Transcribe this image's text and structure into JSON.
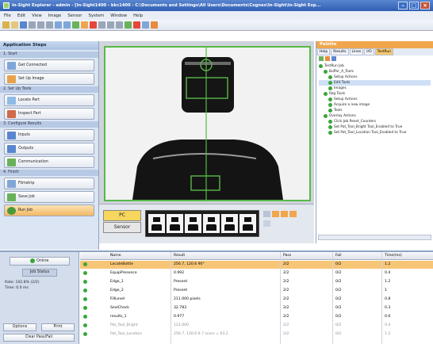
{
  "window": {
    "title": "In-Sight Explorer - admin - [In-Sight1400 - bkc1400 - C:\\Documents and Settings\\All Users\\Documents\\Cognex\\In-Sight\\In-Sight Exp..."
  },
  "menu": [
    "File",
    "Edit",
    "View",
    "Image",
    "Sensor",
    "System",
    "Window",
    "Help"
  ],
  "left": {
    "title": "Application Steps",
    "sections": [
      {
        "header": "1. Start",
        "items": [
          "Get Connected",
          "Set Up Image"
        ]
      },
      {
        "header": "2. Set Up Tools",
        "items": [
          "Locate Part",
          "Inspect Part"
        ]
      },
      {
        "header": "3. Configure Results",
        "items": [
          "Inputs",
          "Outputs",
          "Communication"
        ]
      },
      {
        "header": "4. Finish",
        "items": [
          "Filmstrip",
          "Save Job",
          "Run Job"
        ]
      }
    ]
  },
  "filmstrip": {
    "pc_label": "PC",
    "sensor_label": "Sensor"
  },
  "palette": {
    "title": "Palette",
    "tabs": [
      "Help",
      "Results",
      "Lines",
      "I/O",
      "TestRun"
    ],
    "tree": [
      "TestRun Job",
      "Buffer_A_Tools",
      "Setup Actions",
      "Edit Tools",
      "Images",
      "Reg Tools",
      "Setup Actions",
      "Acquire a new image",
      "Tools",
      "Overlay Actions",
      "Click Job Reset_Counters",
      "Set Pat_Tool_Bright Tool_Enabled to True",
      "Set Pat_Tool_Location Tool_Enabled to True"
    ]
  },
  "status": {
    "online_label": "Online",
    "job_status": "Job Status",
    "rate": "Rate: 102.8% (2/2)",
    "time": "Time: 0.0 ms",
    "options_label": "Options",
    "print_label": "Print",
    "clear_label": "Clear Pass/Fail"
  },
  "table": {
    "columns": [
      "Name",
      "Result",
      "Pass",
      "Fail",
      "Time(ms)"
    ],
    "rows": [
      {
        "name": "LocateBottle",
        "result": "256.7, 120.6 90°",
        "pass": "2/2",
        "fail": "0/2",
        "time": "1.2",
        "selected": true
      },
      {
        "name": "EquipPresence",
        "result": "0.992",
        "pass": "2/2",
        "fail": "0/2",
        "time": "0.4"
      },
      {
        "name": "Edge_1",
        "result": "Present",
        "pass": "2/2",
        "fail": "0/2",
        "time": "1.2"
      },
      {
        "name": "Edge_2",
        "result": "Present",
        "pass": "2/2",
        "fail": "0/2",
        "time": "1"
      },
      {
        "name": "FillLevel",
        "result": "211.000 pixels",
        "pass": "2/2",
        "fail": "0/2",
        "time": "0.8"
      },
      {
        "name": "SealCheck",
        "result": "32.783",
        "pass": "2/2",
        "fail": "0/2",
        "time": "0.3"
      },
      {
        "name": "results_1",
        "result": "0.977",
        "pass": "2/2",
        "fail": "0/2",
        "time": "0.6"
      },
      {
        "name": "Pat_Tool_Bright",
        "result": "121.000",
        "pass": "2/2",
        "fail": "0/2",
        "time": "0.4"
      },
      {
        "name": "Pat_Tool_Location",
        "result": "256.7, 120.6 9.7 score = 93.2",
        "pass": "2/2",
        "fail": "0/2",
        "time": "1.2"
      }
    ]
  },
  "colors": {
    "accent": "#f0a64d",
    "roi": "#57b947",
    "titlebar": "#2f5fb3"
  }
}
